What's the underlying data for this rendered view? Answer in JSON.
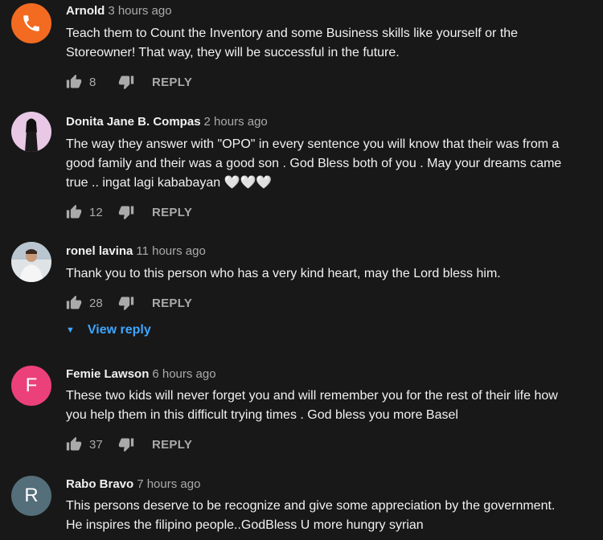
{
  "comments": [
    {
      "author": "Arnold",
      "time": "3 hours ago",
      "text": "Teach them to Count the Inventory and some Business skills like yourself or the Storeowner! That way, they will be successful in the future.",
      "likes": "8",
      "reply_label": "REPLY",
      "avatar_color": "#f26b21"
    },
    {
      "author": "Donita Jane B. Compas",
      "time": "2 hours ago",
      "text": "The way they answer with \"OPO\" in every sentence you will know that their was from a good family and their was a good son . God Bless both of you . May your dreams came true .. ingat lagi kababayan 🤍🤍🤍",
      "likes": "12",
      "reply_label": "REPLY",
      "avatar_color": "#e9c8e6"
    },
    {
      "author": "ronel lavina",
      "time": "11 hours ago",
      "text": "Thank you to this person who has a very kind heart, may the Lord bless him.",
      "likes": "28",
      "reply_label": "REPLY",
      "avatar_color": "#dfe3e6"
    },
    {
      "author": "Femie Lawson",
      "time": "6 hours ago",
      "text": "These two kids will never forget you and will remember you for the rest of their life how you help them in this difficult trying times . God bless you more Basel",
      "likes": "37",
      "reply_label": "REPLY",
      "avatar_color": "#ec407a",
      "avatar_letter": "F"
    },
    {
      "author": "Rabo Bravo",
      "time": "7 hours ago",
      "text": "This persons deserve to be recognize and give some appreciation by the government. He inspires the filipino people..GodBless U more hungry syrian",
      "avatar_color": "#546e7a",
      "avatar_letter": "R"
    }
  ],
  "view_replies": {
    "label": "View reply",
    "color": "#3ea6ff"
  }
}
